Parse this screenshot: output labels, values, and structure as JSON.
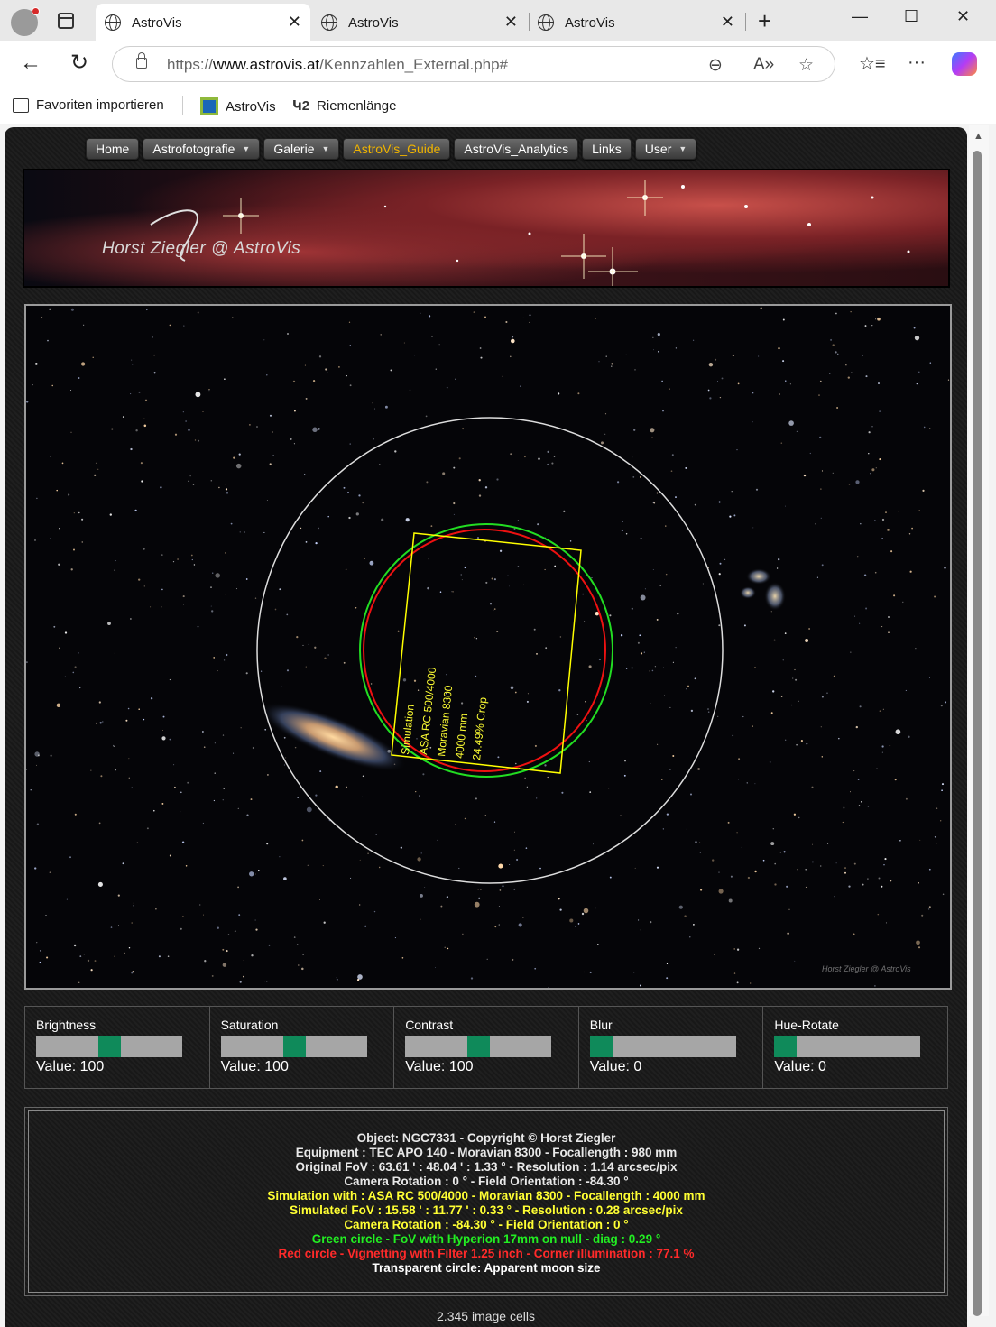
{
  "browser": {
    "tabs": [
      {
        "title": "AstroVis",
        "active": true
      },
      {
        "title": "AstroVis",
        "active": false
      },
      {
        "title": "AstroVis",
        "active": false
      }
    ],
    "url_prefix": "https://",
    "url_host": "www.astrovis.at",
    "url_path": "/Kennzahlen_External.php#",
    "favorites": [
      {
        "label": "Favoriten importieren",
        "icon": "import-icon"
      },
      {
        "label": "AstroVis",
        "icon": "astrovis-icon"
      },
      {
        "label": "Riemenlänge",
        "icon": "ruler-icon"
      }
    ]
  },
  "site": {
    "nav": [
      {
        "label": "Home",
        "dropdown": false,
        "active": false
      },
      {
        "label": "Astrofotografie",
        "dropdown": true,
        "active": false
      },
      {
        "label": "Galerie",
        "dropdown": true,
        "active": false
      },
      {
        "label": "AstroVis_Guide",
        "dropdown": false,
        "active": true
      },
      {
        "label": "AstroVis_Analytics",
        "dropdown": false,
        "active": false
      },
      {
        "label": "Links",
        "dropdown": false,
        "active": false
      },
      {
        "label": "User",
        "dropdown": true,
        "active": false
      }
    ],
    "banner_title": "Horst Ziegler @ AstroVis",
    "overlay": {
      "lines": [
        "Simulation",
        "ASA RC 500/4000",
        "Moravian 8300",
        "4000 mm",
        "24.49% Crop"
      ],
      "watermark": "Horst Ziegler @ AstroVis",
      "colors": {
        "rectangle": "#ffff00",
        "green_circle": "#22dd22",
        "red_circle": "#ee1111",
        "moon_circle": "#dddddd"
      }
    },
    "controls": [
      {
        "label": "Brightness",
        "value_text": "Value: 100",
        "level": 0.5
      },
      {
        "label": "Saturation",
        "value_text": "Value: 100",
        "level": 0.5
      },
      {
        "label": "Contrast",
        "value_text": "Value: 100",
        "level": 0.5
      },
      {
        "label": "Blur",
        "value_text": "Value: 0",
        "level": 0
      },
      {
        "label": "Hue-Rotate",
        "value_text": "Value: 0",
        "level": 0
      }
    ],
    "info": {
      "line1": "Object: NGC7331  -  Copyright © Horst Ziegler",
      "line2": "Equipment : TEC APO 140  -  Moravian 8300  -  Focallength : 980 mm",
      "line3": "Original FoV : 63.61 ' : 48.04 ' : 1.33 °  -  Resolution : 1.14 arcsec/pix",
      "line4": "Camera Rotation : 0 °  -  Field Orientation : -84.30 °",
      "line5": "Simulation with : ASA RC 500/4000  -  Moravian 8300  -  Focallength : 4000 mm",
      "line6": "Simulated FoV : 15.58 ' : 11.77 ' : 0.33 °  -  Resolution : 0.28 arcsec/pix",
      "line7": "Camera Rotation : -84.30 °  -  Field Orientation : 0 °",
      "line8": "Green circle  -  FoV with Hyperion 17mm on null  -  diag : 0.29 °",
      "line9": "Red circle  -  Vignetting with Filter 1.25 inch  -  Corner illumination : 77.1 %",
      "line10": "Transparent circle: Apparent moon size"
    },
    "image_cells": "2.345 image cells"
  }
}
